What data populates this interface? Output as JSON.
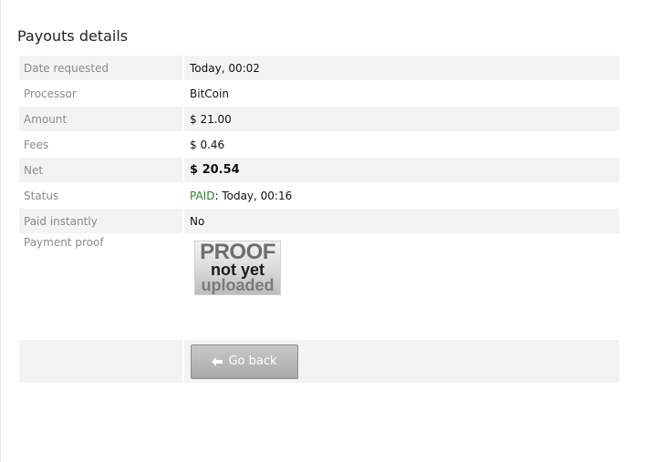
{
  "page": {
    "title": "Payouts details"
  },
  "details": {
    "date_requested": {
      "label": "Date requested",
      "value": "Today, 00:02"
    },
    "processor": {
      "label": "Processor",
      "value": "BitCoin"
    },
    "amount": {
      "label": "Amount",
      "value": "$ 21.00"
    },
    "fees": {
      "label": "Fees",
      "value": "$ 0.46"
    },
    "net": {
      "label": "Net",
      "value": "$ 20.54"
    },
    "status": {
      "label": "Status",
      "state": "PAID",
      "separator": ":",
      "time": " Today, 00:16"
    },
    "paid_instantly": {
      "label": "Paid instantly",
      "value": "No"
    },
    "payment_proof": {
      "label": "Payment proof",
      "placeholder_image": {
        "line1": "PROOF",
        "line2": "not yet",
        "line3": "uploaded"
      }
    }
  },
  "actions": {
    "go_back": {
      "label": "Go back",
      "icon": "arrow-left-icon"
    }
  },
  "colors": {
    "row_shade": "#f3f3f3",
    "label_text": "#8a8a8a",
    "paid_status": "#2f7d2f",
    "button_bg": "#b4b4b4"
  }
}
